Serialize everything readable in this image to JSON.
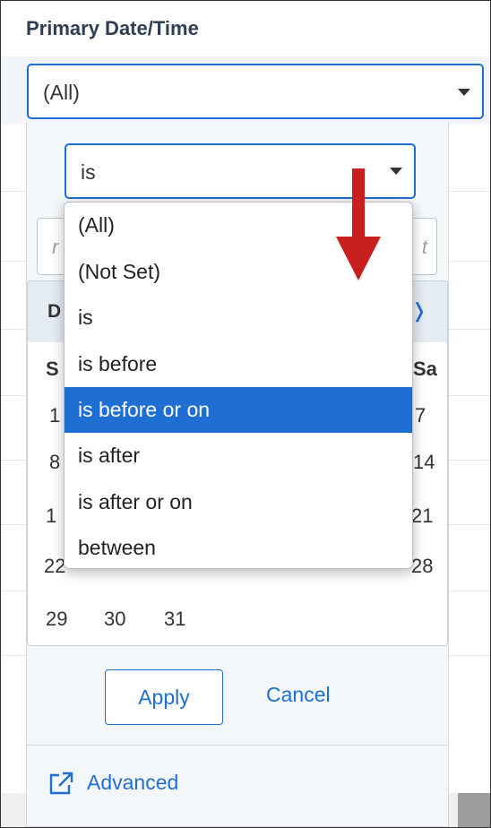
{
  "field": {
    "title": "Primary Date/Time",
    "selected_value": "(All)"
  },
  "operator": {
    "selected": "is",
    "options": [
      {
        "label": "(All)",
        "selected": false
      },
      {
        "label": "(Not Set)",
        "selected": false
      },
      {
        "label": "is",
        "selected": false
      },
      {
        "label": "is before",
        "selected": false
      },
      {
        "label": "is before or on",
        "selected": true
      },
      {
        "label": "is after",
        "selected": false
      },
      {
        "label": "is after or on",
        "selected": false
      },
      {
        "label": "between",
        "selected": false
      }
    ]
  },
  "date_input": {
    "placeholder_left_fragment": "r",
    "placeholder_right_fragment": "t"
  },
  "calendar": {
    "month_label_fragment": "D",
    "next_icon": "chevron-right-icon",
    "weekdays_visible": [
      "S",
      "Sa"
    ],
    "day_fragments": {
      "row1": [
        "1",
        "7"
      ],
      "row2": [
        "8",
        "14"
      ],
      "row3": [
        "1",
        "21"
      ],
      "row4": [
        "22",
        "28"
      ],
      "row5": [
        "29",
        "30",
        "31"
      ]
    }
  },
  "actions": {
    "apply_label": "Apply",
    "cancel_label": "Cancel",
    "advanced_label": "Advanced",
    "advanced_icon": "external-link-icon"
  },
  "colors": {
    "accent": "#1f6ed4",
    "arrow": "#c81e1e",
    "header_text": "#2f3e52"
  }
}
